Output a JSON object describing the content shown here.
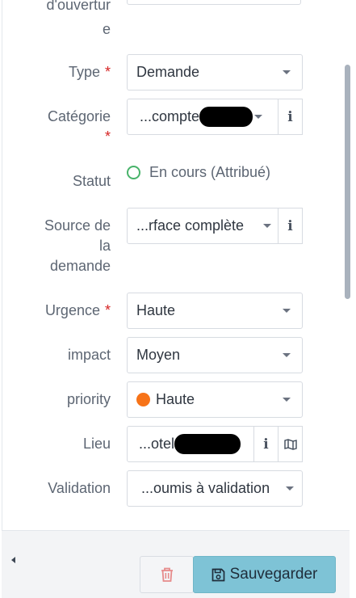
{
  "form": {
    "opening_label_part1": "d'ouvertur",
    "opening_label_part2": "e",
    "type": {
      "label": "Type",
      "value": "Demande"
    },
    "category": {
      "label": "Catégorie",
      "value": "...compte"
    },
    "status": {
      "label": "Statut",
      "value": "En cours (Attribué)"
    },
    "source": {
      "label_line1": "Source de",
      "label_line2": "la",
      "label_line3": "demande",
      "value": "...rface complète"
    },
    "urgency": {
      "label": "Urgence",
      "value": "Haute"
    },
    "impact": {
      "label": "impact",
      "value": "Moyen"
    },
    "priority": {
      "label": "priority",
      "value": "Haute"
    },
    "location": {
      "label": "Lieu",
      "value": "...otel"
    },
    "validation": {
      "label": "Validation",
      "value": "...oumis à validation"
    },
    "required_mark": "*"
  },
  "footer": {
    "save_label": "Sauvegarder"
  },
  "icons": {
    "info": "i",
    "map": "map-icon",
    "trash": "trash-icon",
    "save": "floppy-disk-icon"
  },
  "colors": {
    "required": "#d62424",
    "status_circle": "#48b36a",
    "priority_dot": "#f77318",
    "save_button": "#7ec3d6"
  }
}
